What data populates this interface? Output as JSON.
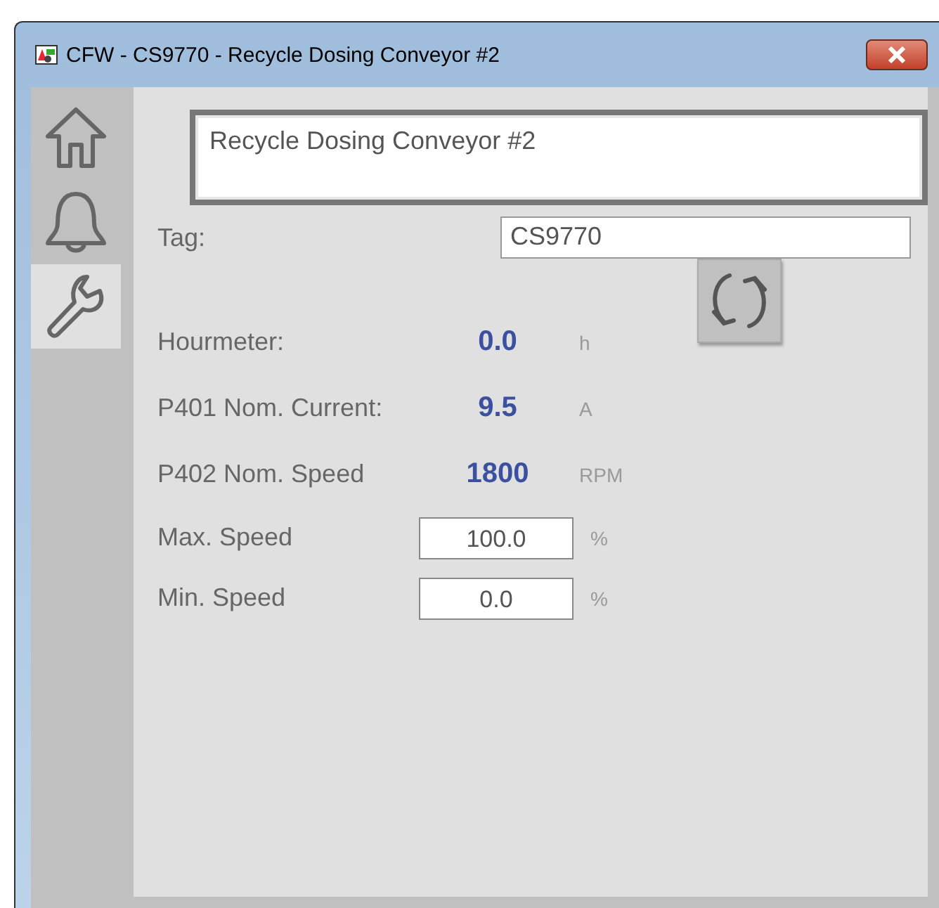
{
  "window": {
    "title": "CFW - CS9770 - Recycle Dosing Conveyor #2"
  },
  "tabs": [
    {
      "kind": "home",
      "selected": false
    },
    {
      "kind": "bell",
      "selected": false
    },
    {
      "kind": "wrench",
      "selected": true
    }
  ],
  "description": "Recycle Dosing Conveyor #2",
  "tag": {
    "label": "Tag:",
    "value": "CS9770"
  },
  "readouts": [
    {
      "label": "Hourmeter:",
      "value": "0.0",
      "unit": "h"
    },
    {
      "label": "P401 Nom. Current:",
      "value": "9.5",
      "unit": "A"
    },
    {
      "label": "P402 Nom. Speed",
      "value": "1800",
      "unit": "RPM"
    }
  ],
  "settings": [
    {
      "label": "Max. Speed",
      "value": "100.0",
      "unit": "%"
    },
    {
      "label": "Min. Speed",
      "value": "0.0",
      "unit": "%"
    }
  ]
}
